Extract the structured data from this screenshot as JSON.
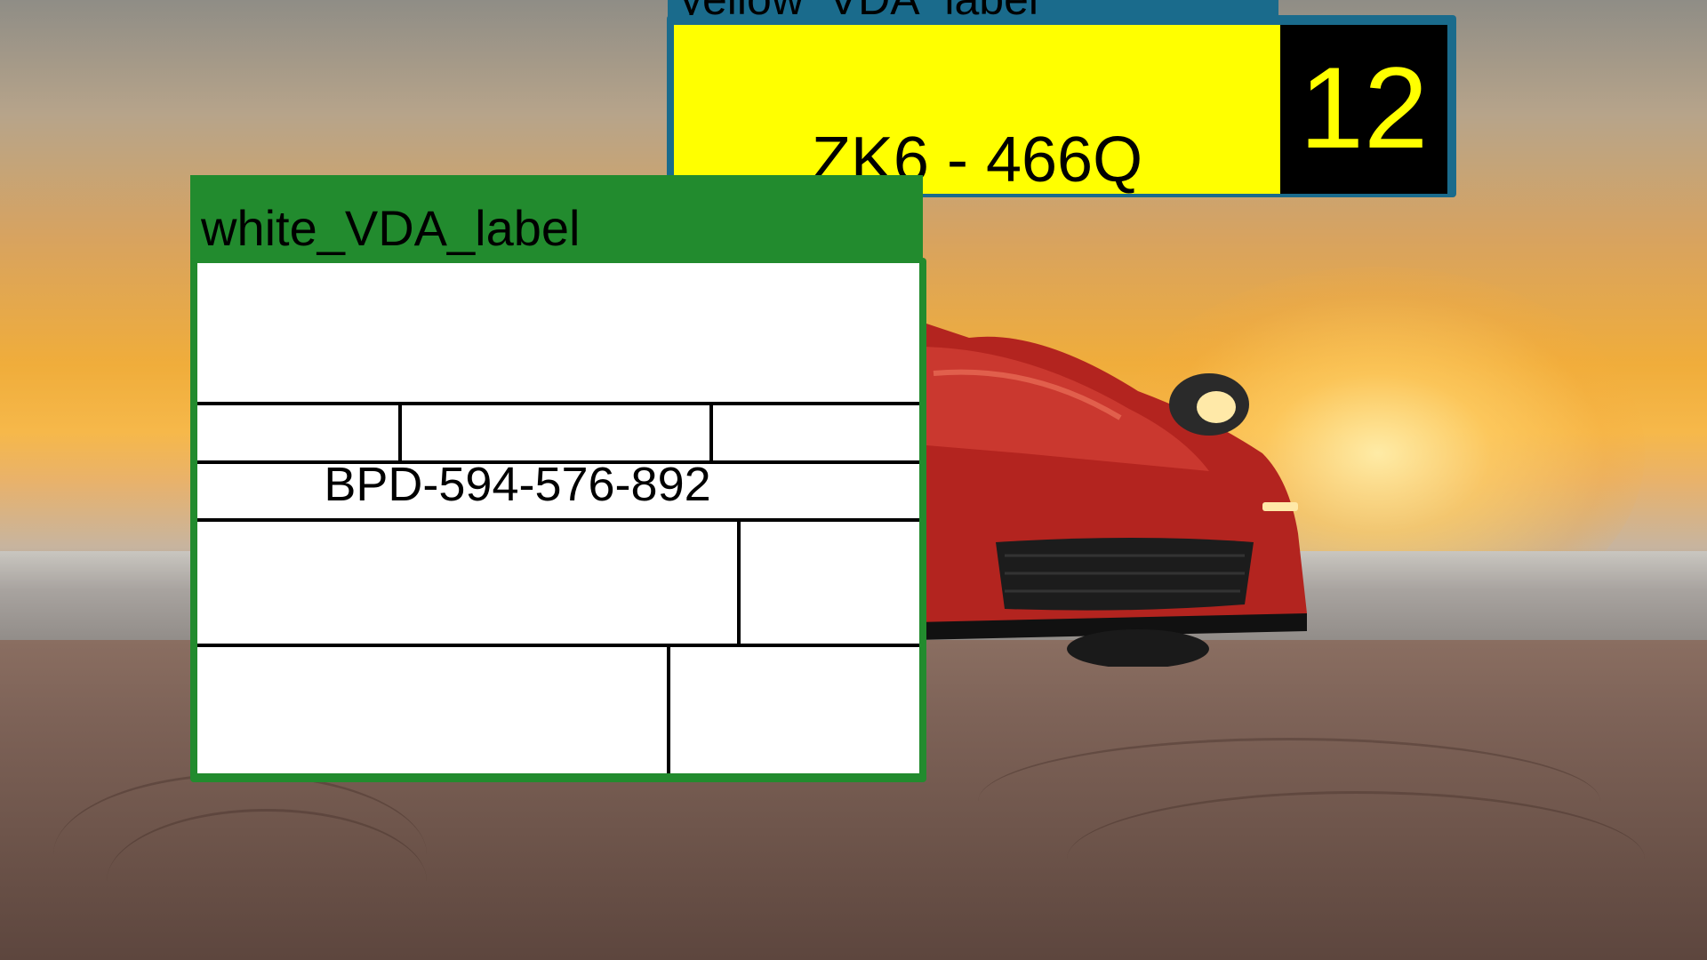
{
  "yellow_label": {
    "header_label": "yellow_VDA_label",
    "plate_text": "ZK6 - 466Q",
    "count": "12",
    "colors": {
      "frame": "#1a6b8c",
      "field": "#ffff00",
      "count_background": "#000000",
      "count_text": "#ffff00"
    }
  },
  "white_label": {
    "header_label": "white_VDA_label",
    "serial": "BPD-594-576-892",
    "colors": {
      "frame": "#228b2e",
      "body": "#ffffff"
    }
  },
  "background": {
    "scene": "red sports car on beach at sunset"
  }
}
